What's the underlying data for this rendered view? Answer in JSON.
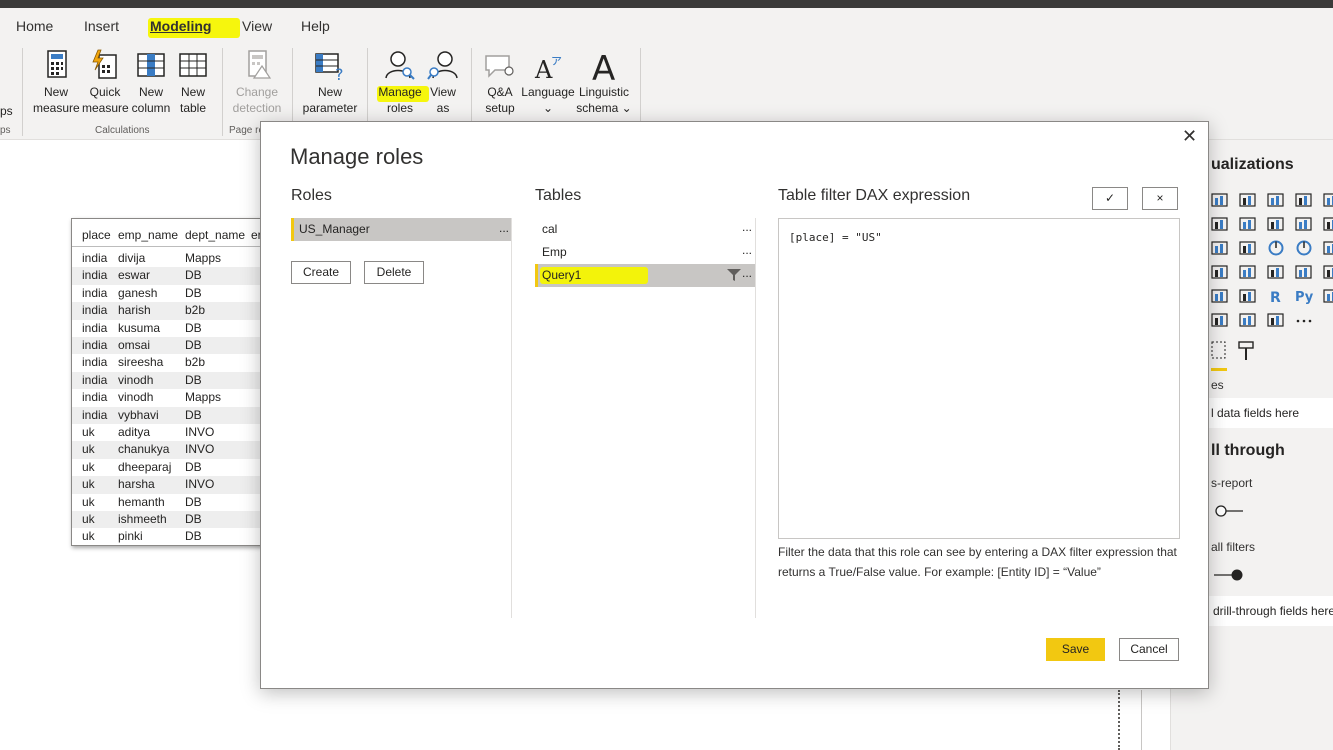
{
  "menu": {
    "items": [
      "Home",
      "Insert",
      "Modeling",
      "View",
      "Help"
    ]
  },
  "ribbon": {
    "partial_left_label1": "ps",
    "partial_left_label2": "ps",
    "new_measure": [
      "New",
      "measure"
    ],
    "quick_measure": [
      "Quick",
      "measure"
    ],
    "new_column": [
      "New",
      "column"
    ],
    "new_table": [
      "New",
      "table"
    ],
    "calculations_group": "Calculations",
    "change_detection": [
      "Change",
      "detection"
    ],
    "page_refresh_group": "Page re",
    "new_parameter": [
      "New",
      "parameter"
    ],
    "manage_roles": [
      "Manage",
      "roles"
    ],
    "view_as": [
      "View",
      "as"
    ],
    "qa_setup": [
      "Q&A",
      "setup"
    ],
    "language": [
      "Language",
      "⌄"
    ],
    "linguistic_schema": [
      "Linguistic",
      "schema ⌄"
    ]
  },
  "table_visual": {
    "columns": [
      "place",
      "emp_name",
      "dept_name",
      "er"
    ],
    "rows": [
      [
        "india",
        "divija",
        "Mapps"
      ],
      [
        "india",
        "eswar",
        "DB"
      ],
      [
        "india",
        "ganesh",
        "DB"
      ],
      [
        "india",
        "harish",
        "b2b"
      ],
      [
        "india",
        "kusuma",
        "DB"
      ],
      [
        "india",
        "omsai",
        "DB"
      ],
      [
        "india",
        "sireesha",
        "b2b"
      ],
      [
        "india",
        "vinodh",
        "DB"
      ],
      [
        "india",
        "vinodh",
        "Mapps"
      ],
      [
        "india",
        "vybhavi",
        "DB"
      ],
      [
        "uk",
        "aditya",
        "INVO"
      ],
      [
        "uk",
        "chanukya",
        "INVO"
      ],
      [
        "uk",
        "dheeparaj",
        "DB"
      ],
      [
        "uk",
        "harsha",
        "INVO"
      ],
      [
        "uk",
        "hemanth",
        "DB"
      ],
      [
        "uk",
        "ishmeeth",
        "DB"
      ],
      [
        "uk",
        "pinki",
        "DB"
      ]
    ]
  },
  "right_pane": {
    "title": "ualizations",
    "fields_label": "es",
    "add_fields": "l data fields here",
    "drill_through": "ll through",
    "cross_report": "s-report",
    "keep_filters": "all filters",
    "drill_fields": "drill-through fields here"
  },
  "modal": {
    "title": "Manage roles",
    "close": "✕",
    "roles_head": "Roles",
    "tables_head": "Tables",
    "dax_head": "Table filter DAX expression",
    "roles": [
      "US_Manager"
    ],
    "create_label": "Create",
    "delete_label": "Delete",
    "tables": [
      "cal",
      "Emp",
      "Query1"
    ],
    "selected_table": "Query1",
    "more": "...",
    "check": "✓",
    "cancel_x": "×",
    "dax_expression": "[place] = \"US\"",
    "help": "Filter the data that this role can see by entering a DAX filter expression that returns a True/False value. For example: [Entity ID] = “Value”",
    "save_label": "Save",
    "cancel_label": "Cancel"
  },
  "colors": {
    "accent": "#f2c811",
    "highlight": "#f5f500",
    "selection": "#c8c6c4"
  }
}
